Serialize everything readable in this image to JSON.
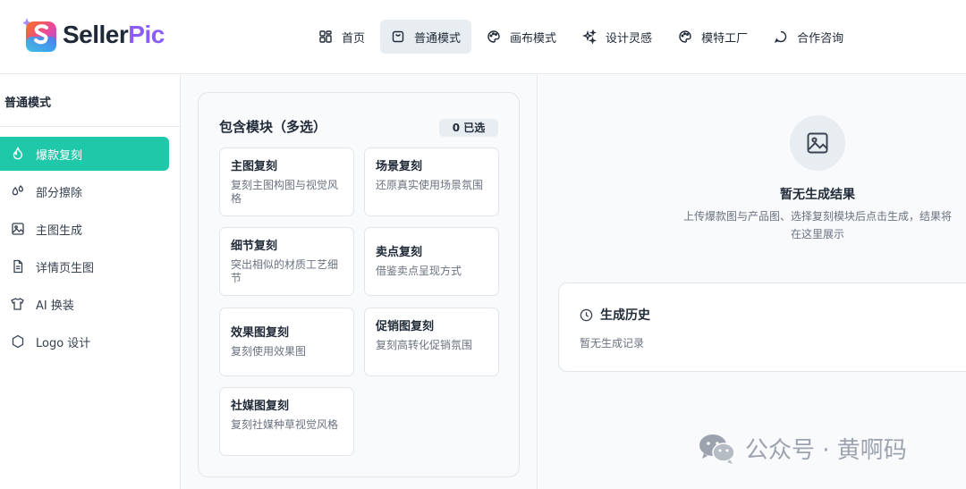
{
  "brand": {
    "seller": "Seller",
    "pic": "Pic"
  },
  "nav": [
    {
      "label": "首页",
      "icon": "home-icon"
    },
    {
      "label": "普通模式",
      "icon": "bag-icon",
      "active": true
    },
    {
      "label": "画布模式",
      "icon": "palette-icon"
    },
    {
      "label": "设计灵感",
      "icon": "sparkles-icon"
    },
    {
      "label": "模特工厂",
      "icon": "palette-icon"
    },
    {
      "label": "合作咨询",
      "icon": "chat-icon"
    }
  ],
  "sidebar": {
    "title": "普通模式",
    "items": [
      {
        "label": "爆款复刻",
        "icon": "flame-icon",
        "active": true
      },
      {
        "label": "部分擦除",
        "icon": "droplets-icon"
      },
      {
        "label": "主图生成",
        "icon": "image-icon"
      },
      {
        "label": "详情页生图",
        "icon": "document-icon"
      },
      {
        "label": "AI 换装",
        "icon": "shirt-icon"
      },
      {
        "label": "Logo 设计",
        "icon": "hexagon-icon"
      }
    ]
  },
  "modules": {
    "title": "包含模块（多选）",
    "selected_count": "0 已选",
    "options": [
      {
        "title": "主图复刻",
        "desc": "复刻主图构图与视觉风格"
      },
      {
        "title": "场景复刻",
        "desc": "还原真实使用场景氛围"
      },
      {
        "title": "细节复刻",
        "desc": "突出相似的材质工艺细节"
      },
      {
        "title": "卖点复刻",
        "desc": "借鉴卖点呈现方式"
      },
      {
        "title": "效果图复刻",
        "desc": "复刻使用效果图"
      },
      {
        "title": "促销图复刻",
        "desc": "复刻高转化促销氛围"
      },
      {
        "title": "社媒图复刻",
        "desc": "复刻社媒种草视觉风格"
      }
    ]
  },
  "result": {
    "empty_title": "暂无生成结果",
    "empty_desc": "上传爆款图与产品图、选择复刻模块后点击生成，结果将在这里展示"
  },
  "history": {
    "title": "生成历史",
    "empty": "暂无生成记录"
  },
  "watermark": "公众号 · 黄啊码",
  "colors": {
    "accent": "#1fc8a8",
    "brand_purple": "#8b5cf6"
  }
}
